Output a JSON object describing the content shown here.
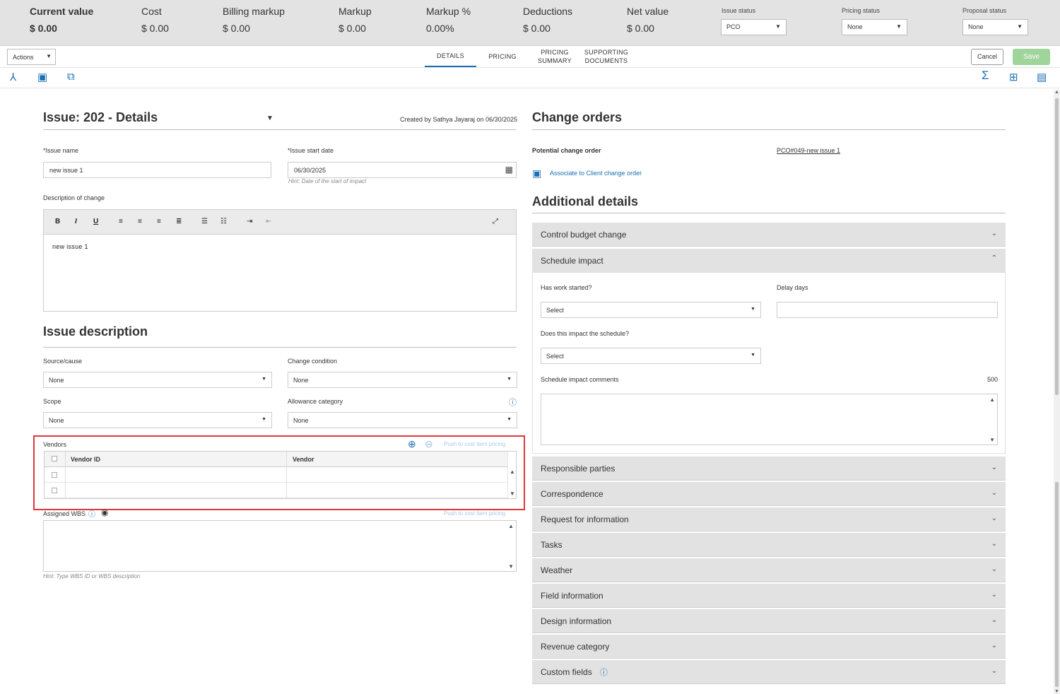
{
  "summary": {
    "items": [
      {
        "label": "Current value",
        "value": "$ 0.00"
      },
      {
        "label": "Cost",
        "value": "$ 0.00"
      },
      {
        "label": "Billing markup",
        "value": "$ 0.00"
      },
      {
        "label": "Markup",
        "value": "$ 0.00"
      },
      {
        "label": "Markup %",
        "value": "0.00%"
      },
      {
        "label": "Deductions",
        "value": "$ 0.00"
      },
      {
        "label": "Net value",
        "value": "$ 0.00"
      }
    ],
    "statuses": [
      {
        "label": "Issue status",
        "value": "PCO"
      },
      {
        "label": "Pricing status",
        "value": "None"
      },
      {
        "label": "Proposal status",
        "value": "None"
      }
    ]
  },
  "toolbar": {
    "actions_label": "Actions",
    "tabs": [
      "DETAILS",
      "PRICING",
      "PRICING SUMMARY",
      "SUPPORTING DOCUMENTS"
    ],
    "cancel_label": "Cancel",
    "save_label": "Save"
  },
  "issue": {
    "title": "Issue:  202 - Details",
    "created_by": "Created by Sathya Jayaraj on 06/30/2025",
    "name_label": "*Issue name",
    "name_value": "new issue 1",
    "start_label": "*Issue start date",
    "start_value": "06/30/2025",
    "start_hint": "Hint: Date of the start of impact",
    "desc_label": "Description of change",
    "desc_value": "new issue 1"
  },
  "issue_description": {
    "title": "Issue description",
    "source_label": "Source/cause",
    "source_value": "None",
    "condition_label": "Change condition",
    "condition_value": "None",
    "scope_label": "Scope",
    "scope_value": "None",
    "allowance_label": "Allowance category",
    "allowance_value": "None",
    "vendors_label": "Vendors",
    "push_label": "Push to cost item pricing",
    "vendor_columns": [
      "Vendor ID",
      "Vendor"
    ],
    "wbs_label": "Assigned WBS",
    "wbs_push_label": "Push to cost item pricing",
    "wbs_hint": "Hint: Type WBS ID or WBS description"
  },
  "change_orders": {
    "title": "Change orders",
    "pco_label": "Potential change order",
    "pco_value": "PCO#049-new issue 1",
    "associate_label": "Associate to Client change order"
  },
  "additional": {
    "title": "Additional details",
    "control_budget": "Control budget change",
    "schedule_impact": "Schedule impact",
    "work_started_label": "Has work started?",
    "work_started_value": "Select",
    "delay_label": "Delay days",
    "impact_label": "Does this impact the schedule?",
    "impact_value": "Select",
    "comments_label": "Schedule impact comments",
    "comments_count": "500",
    "sections": [
      "Responsible parties",
      "Correspondence",
      "Request for information",
      "Tasks",
      "Weather",
      "Field information",
      "Design information",
      "Revenue category",
      "Custom fields"
    ]
  }
}
